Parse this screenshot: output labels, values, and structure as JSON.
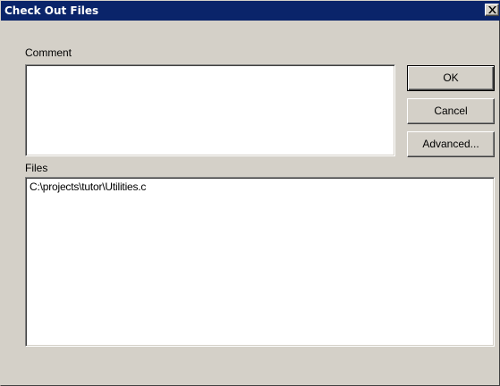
{
  "window": {
    "title": "Check Out Files"
  },
  "comment": {
    "label": "Comment",
    "value": ""
  },
  "buttons": {
    "ok": "OK",
    "cancel": "Cancel",
    "advanced": "Advanced..."
  },
  "files": {
    "label": "Files",
    "items": [
      "C:\\projects\\tutor\\Utilities.c"
    ]
  },
  "icons": {
    "close": "close-icon"
  },
  "colors": {
    "titlebar": "#0a246a",
    "face": "#d4d0c8"
  }
}
